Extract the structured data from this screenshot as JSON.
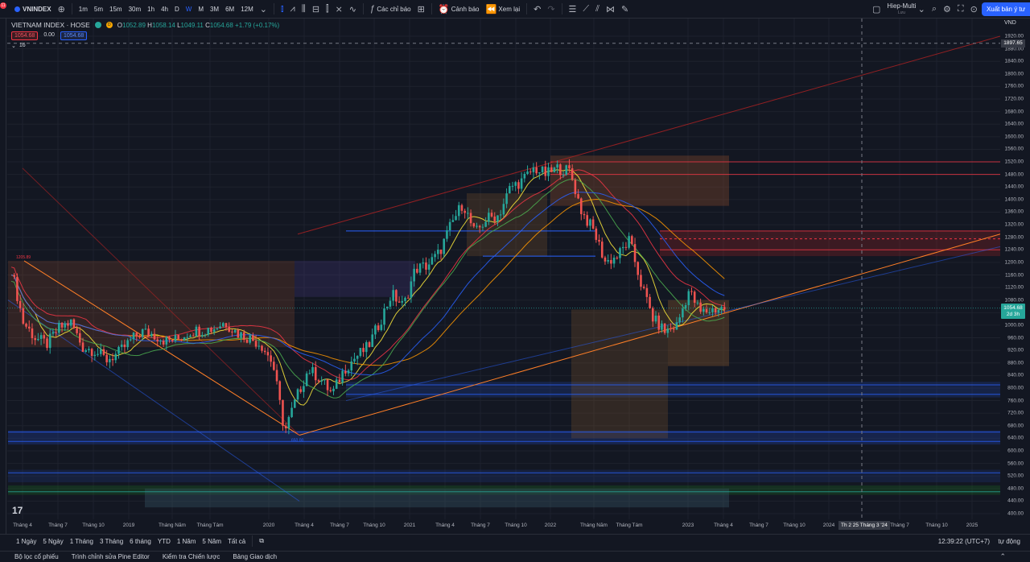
{
  "toolbar": {
    "notification_count": "11",
    "symbol": "VNINDEX",
    "intervals": [
      "1m",
      "5m",
      "15m",
      "30m",
      "1h",
      "4h",
      "D",
      "W",
      "M",
      "3M",
      "6M",
      "12M"
    ],
    "active_interval": "W",
    "indicators_label": "Các chỉ báo",
    "alert_label": "Cảnh báo",
    "replay_label": "Xem lại",
    "layout_name": "Hiep-Multi",
    "layout_sub": "Lưu",
    "publish_label": "Xuất bản ý tư"
  },
  "legend": {
    "title": "VIETNAM INDEX · HOSE",
    "badge": "D",
    "open_key": "O",
    "open": "1052.89",
    "high_key": "H",
    "high": "1058.14",
    "low_key": "L",
    "low": "1049.11",
    "close_key": "C",
    "close": "1054.68",
    "change": "+1.79 (+0.17%)",
    "sell_price": "1054.68",
    "spread": "0.00",
    "buy_price": "1054.68",
    "indicator_count": "16"
  },
  "price_axis": {
    "currency": "VND",
    "ticks": [
      "1920.00",
      "1880.00",
      "1840.00",
      "1800.00",
      "1760.00",
      "1720.00",
      "1680.00",
      "1640.00",
      "1600.00",
      "1560.00",
      "1520.00",
      "1480.00",
      "1440.00",
      "1400.00",
      "1360.00",
      "1320.00",
      "1280.00",
      "1240.00",
      "1200.00",
      "1160.00",
      "1120.00",
      "1080.00",
      "1040.00",
      "1000.00",
      "960.00",
      "920.00",
      "880.00",
      "840.00",
      "800.00",
      "760.00",
      "720.00",
      "680.00",
      "640.00",
      "600.00",
      "560.00",
      "520.00",
      "480.00",
      "440.00",
      "400.00"
    ],
    "last_price": "1054.68",
    "last_countdown": "2d 3h",
    "crosshair_price": "1897.65"
  },
  "time_axis": {
    "ticks": [
      "Tháng 4",
      "Tháng 7",
      "Tháng 10",
      "2019",
      "Tháng Năm",
      "Tháng Tám",
      "2020",
      "Tháng 4",
      "Tháng 7",
      "Tháng 10",
      "2021",
      "Tháng 4",
      "Tháng 7",
      "Tháng 10",
      "2022",
      "Tháng Năm",
      "Tháng Tám",
      "2023",
      "Tháng 4",
      "Tháng 7",
      "Tháng 10",
      "2024",
      "Tháng 7",
      "Tháng 10",
      "2025"
    ],
    "crosshair_time": "Th 2 25 Tháng 3 '24"
  },
  "annotations": {
    "peak_label": "1205.89",
    "low_label": "650.00"
  },
  "bottom": {
    "ranges": [
      "1 Ngày",
      "5 Ngày",
      "1 Tháng",
      "3 Tháng",
      "6 tháng",
      "YTD",
      "1 Năm",
      "5 Năm",
      "Tất cả"
    ],
    "clock": "12:39:22 (UTC+7)",
    "adjust_label": "tự động"
  },
  "panels": [
    "Bộ lọc cổ phiếu",
    "Trình chỉnh sửa Pine Editor",
    "Kiểm tra Chiến lược",
    "Bảng Giao dịch"
  ],
  "chart_data": {
    "type": "candlestick",
    "symbol": "VIETNAM INDEX · HOSE",
    "y_range": [
      400,
      1920
    ],
    "x": [
      "2018-04",
      "2018-05",
      "2018-06",
      "2018-07",
      "2018-08",
      "2018-09",
      "2018-10",
      "2018-11",
      "2018-12",
      "2019-01",
      "2019-02",
      "2019-03",
      "2019-04",
      "2019-05",
      "2019-06",
      "2019-07",
      "2019-08",
      "2019-09",
      "2019-10",
      "2019-11",
      "2019-12",
      "2020-01",
      "2020-02",
      "2020-03",
      "2020-04",
      "2020-05",
      "2020-06",
      "2020-07",
      "2020-08",
      "2020-09",
      "2020-10",
      "2020-11",
      "2020-12",
      "2021-01",
      "2021-02",
      "2021-03",
      "2021-04",
      "2021-05",
      "2021-06",
      "2021-07",
      "2021-08",
      "2021-09",
      "2021-10",
      "2021-11",
      "2021-12",
      "2022-01",
      "2022-02",
      "2022-03",
      "2022-04",
      "2022-05",
      "2022-06",
      "2022-07",
      "2022-08",
      "2022-09",
      "2022-10",
      "2022-11",
      "2022-12",
      "2023-01",
      "2023-02",
      "2023-03",
      "2023-04"
    ],
    "close": [
      1180,
      1010,
      960,
      940,
      990,
      1010,
      930,
      920,
      890,
      910,
      950,
      980,
      970,
      950,
      955,
      980,
      985,
      990,
      1010,
      975,
      960,
      940,
      880,
      660,
      770,
      860,
      830,
      780,
      860,
      900,
      930,
      1010,
      1100,
      1060,
      1180,
      1190,
      1230,
      1320,
      1390,
      1290,
      1340,
      1350,
      1440,
      1460,
      1500,
      1480,
      1500,
      1490,
      1360,
      1300,
      1200,
      1220,
      1270,
      1130,
      1020,
      980,
      1000,
      1110,
      1040,
      1050,
      1054
    ],
    "levels": [
      1520,
      1480,
      1240,
      1300,
      810,
      780,
      660,
      630,
      520,
      480
    ],
    "ichimoku_cloud": true,
    "moving_averages": 5
  }
}
